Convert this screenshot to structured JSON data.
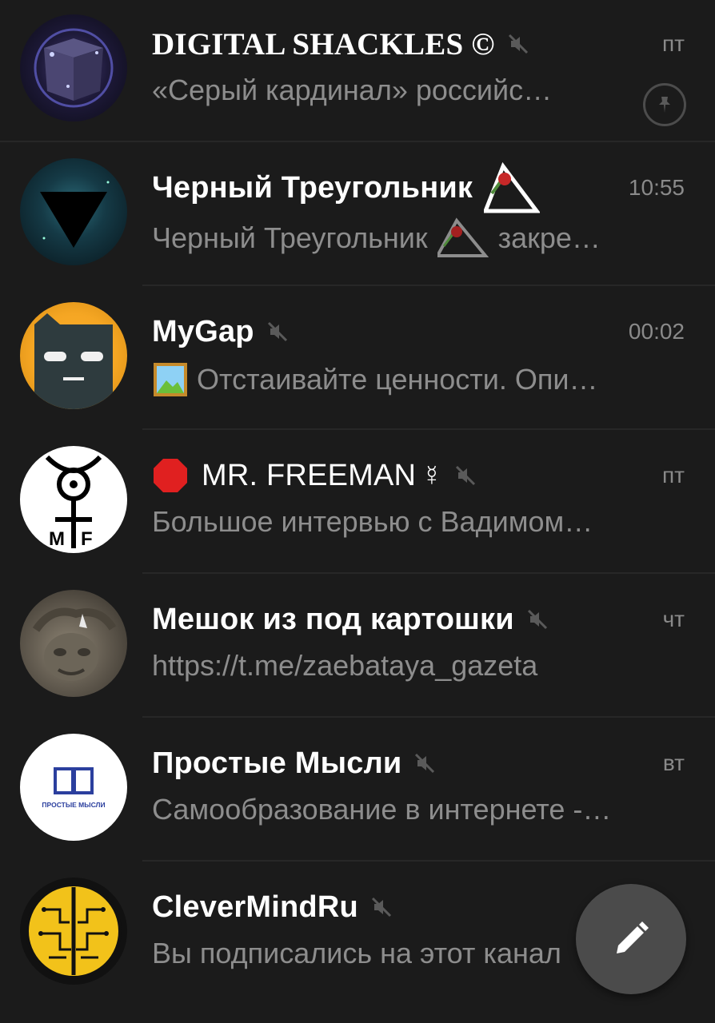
{
  "colors": {
    "background": "#1b1b1b",
    "title": "#ffffff",
    "secondary": "#8d8d8d",
    "divider": "#272727",
    "fab": "#4b4b4b"
  },
  "chats": [
    {
      "title": "DIGITAL SHACKLES ©",
      "muted": true,
      "time": "пт",
      "preview": "«Серый кардинал» российс…",
      "pinned": true
    },
    {
      "title": "Черный Треугольник",
      "muted": false,
      "time": "10:55",
      "preview_start": "Черный Треугольник",
      "preview_end": "закре…"
    },
    {
      "title": "MyGap",
      "muted": true,
      "time": "00:02",
      "preview": "Отстаивайте ценности.  Опи…"
    },
    {
      "title": "MR. FREEMAN",
      "title_symbol": "☿",
      "muted": true,
      "time": "пт",
      "preview": "Большое интервью с Вадимом…"
    },
    {
      "title": "Мешок из под картошки",
      "muted": true,
      "time": "чт",
      "preview": "https://t.me/zaebataya_gazeta"
    },
    {
      "title": "Простые Мысли",
      "muted": true,
      "time": "вт",
      "preview": "Самообразование в интернете -…",
      "avatar_text": "ПРОСТЫЕ МЫСЛИ"
    },
    {
      "title": "CleverMindRu",
      "muted": true,
      "time": "",
      "preview": "Вы подписались на этот канал"
    }
  ],
  "fab": {
    "icon": "pencil-icon"
  },
  "icons": {
    "mute": "muted-speaker-icon",
    "pin": "pin-icon",
    "stop": "stop-sign-icon",
    "photo": "photo-icon"
  }
}
